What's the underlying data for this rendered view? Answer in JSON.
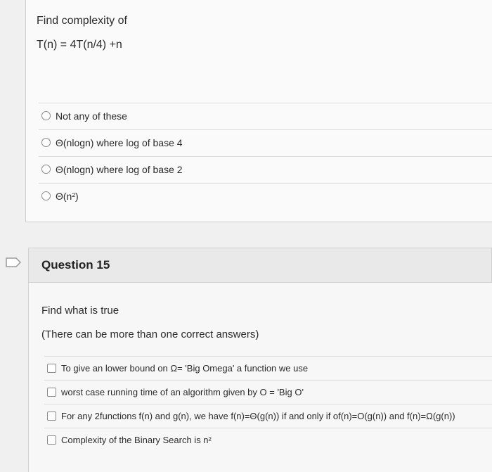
{
  "q14": {
    "stem_line1": "Find complexity of",
    "stem_line2": "T(n) = 4T(n/4) +n",
    "options": [
      "Not any of these",
      "Θ(nlogn) where log of base 4",
      "Θ(nlogn) where log of base 2",
      "Θ(n²)"
    ]
  },
  "q15": {
    "title": "Question 15",
    "stem_line1": "Find what is true",
    "stem_line2": "(There can be more than one correct answers)",
    "options": [
      "To give an lower bound on Ω= 'Big Omega' a function we use",
      "worst case running time of an algorithm given by O = 'Big O'",
      "For any 2functions f(n) and g(n), we have f(n)=Θ(g(n)) if and only if of(n)=O(g(n)) and f(n)=Ω(g(n))",
      "Complexity of the Binary Search is n²"
    ]
  }
}
